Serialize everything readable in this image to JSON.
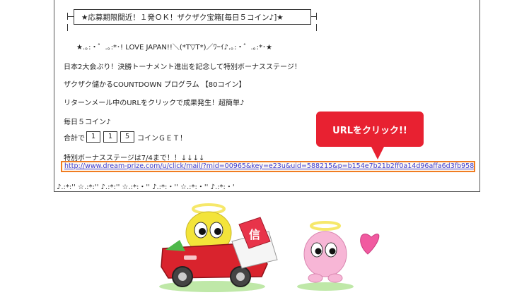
{
  "banner": {
    "title": "★応募期限間近！１発ＯＫ！ザクザク宝箱[毎日５コイン♪]★"
  },
  "stars_line": "★.｡:・゜.｡:*･!  LOVE JAPAN!!＼(*T▽T*)／ﾜｰｲ♪.｡:・゜.｡:*･★",
  "body_lines": [
    "日本2大会ぶり！決勝トーナメント進出を記念して特別ボーナスステージ！",
    "ザクザク儲かるCOUNTDOWN プログラム 【80コイン】",
    "リターンメール中のURLをクリックで成果発生！超簡単♪",
    "毎日５コイン♪"
  ],
  "countdown": {
    "prefix": "合計で",
    "digits": [
      "1",
      "1",
      "5"
    ],
    "suffix": "コインＧＥＴ！"
  },
  "deadline_line": "特別ボーナスステージは7/4まで！！↓↓↓↓",
  "url": "http://www.dream-prize.com/u/click/mail/?mid=00965&key=e23u&uid=588215&p=b154e7b21b2ff0a14d96affa6d3fb958",
  "footer_line": "♪.:*:'' ☆.:*:'' ♪.:*:'' ☆.:*:・'' ♪.:*:・'' ☆.:*:・'' ♪.:*:・'",
  "callout": {
    "label": "URLをクリック!!"
  },
  "colors": {
    "callout_red": "#e82131",
    "url_highlight": "#f07c22",
    "link_blue": "#3b3bd0",
    "car_red": "#d9232d",
    "mascot_yellow": "#f3e43a",
    "mascot_pink": "#f7b6d6",
    "heart_pink": "#f15aa0"
  },
  "illustration": {
    "letter_glyph": "信"
  }
}
